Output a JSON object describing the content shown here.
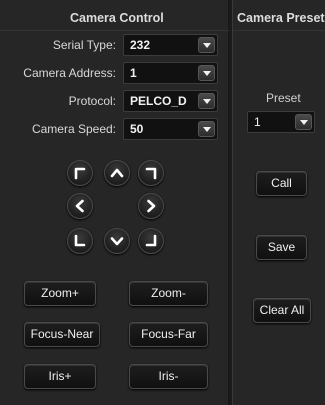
{
  "camera_control": {
    "title": "Camera Control",
    "fields": [
      {
        "label": "Serial Type:",
        "value": "232"
      },
      {
        "label": "Camera Address:",
        "value": "1"
      },
      {
        "label": "Protocol:",
        "value": "PELCO_D"
      },
      {
        "label": "Camera Speed:",
        "value": "50"
      }
    ],
    "ptz_icons": [
      "arrow-up-left-icon",
      "arrow-up-icon",
      "arrow-up-right-icon",
      "arrow-left-icon",
      "arrow-right-icon",
      "arrow-down-left-icon",
      "arrow-down-icon",
      "arrow-down-right-icon"
    ],
    "buttons": {
      "zoom_in": "Zoom+",
      "zoom_out": "Zoom-",
      "focus_near": "Focus-Near",
      "focus_far": "Focus-Far",
      "iris_open": "Iris+",
      "iris_close": "Iris-"
    }
  },
  "camera_presets": {
    "title": "Camera Presets",
    "preset_label": "Preset",
    "preset_value": "1",
    "buttons": {
      "call": "Call",
      "save": "Save",
      "clear_all": "Clear All"
    }
  }
}
